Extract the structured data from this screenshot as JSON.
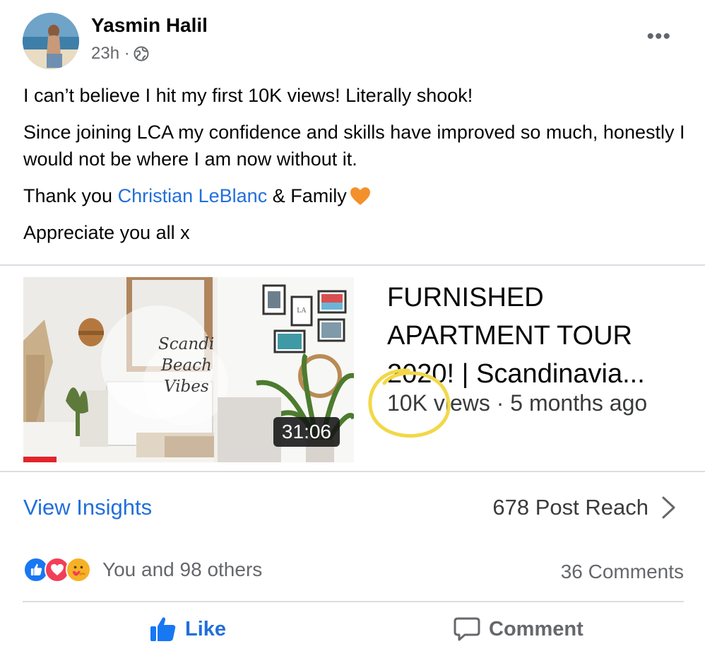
{
  "post": {
    "author": "Yasmin Halil",
    "time": "23h ·",
    "privacy_icon": "globe-icon",
    "more_label": "•••",
    "lines": {
      "line1": "I can’t believe I hit my first 10K views! Literally shook!",
      "line2": "Since joining LCA my confidence and skills have improved so much, honestly I would not be where I am now without it.",
      "line3_prefix": "Thank you ",
      "line3_mention": "Christian LeBlanc",
      "line3_suffix": " & Family",
      "line4": "Appreciate you all x"
    }
  },
  "video": {
    "title": "FURNISHED APARTMENT TOUR 2020! | Scandinavia...",
    "meta": "10K views · 5 months ago",
    "duration": "31:06",
    "watched_fraction": 0.1,
    "thumb_script": [
      "Scandi",
      "Beach",
      "Vibes"
    ],
    "poster_label": "LA"
  },
  "insights": {
    "link": "View Insights",
    "reach": "678 Post Reach"
  },
  "engagement": {
    "reactions": [
      "like-icon",
      "love-icon",
      "care-icon"
    ],
    "reaction_text": "You and 98 others",
    "comments": "36 Comments"
  },
  "actions": {
    "like": "Like",
    "comment": "Comment"
  },
  "colors": {
    "link": "#216fdb",
    "secondary": "#65676b",
    "highlight_circle": "#f2d848",
    "like_blue": "#1877f2",
    "love_red": "#f33e58",
    "care_yellow": "#f7b125"
  }
}
